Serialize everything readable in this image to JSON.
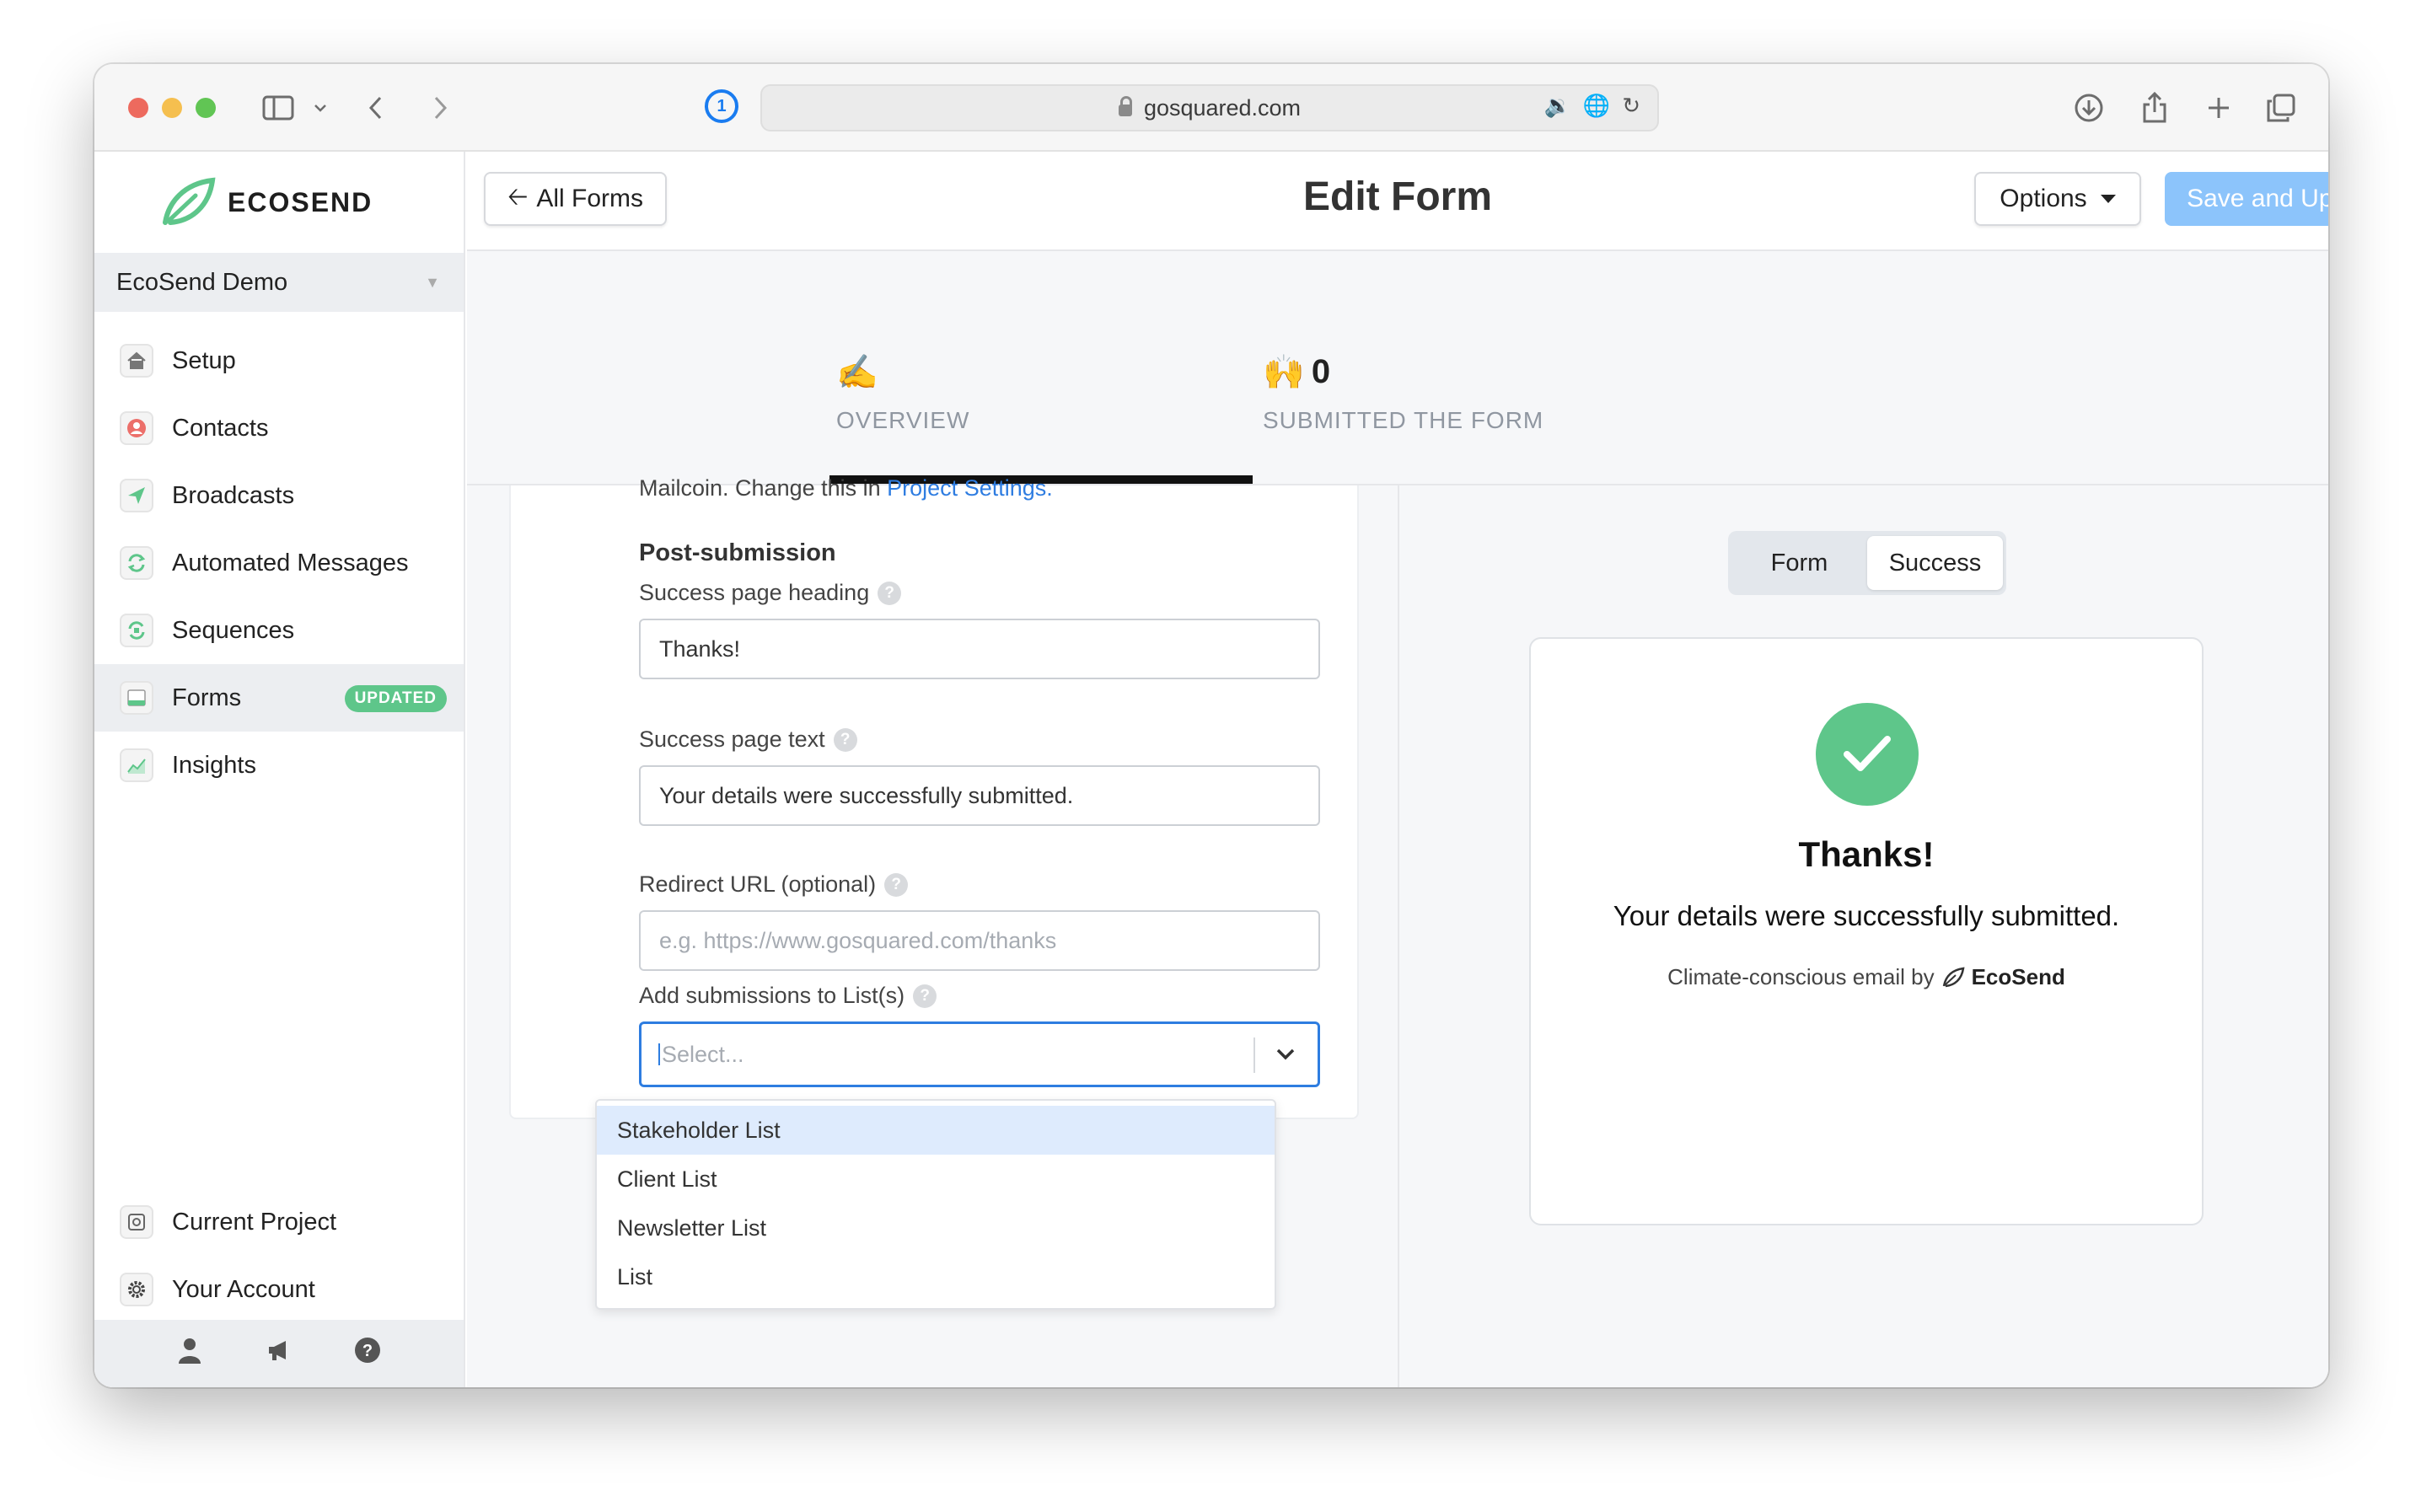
{
  "browser": {
    "url": "gosquared.com"
  },
  "sidebar": {
    "brand": "ECOSEND",
    "project": "EcoSend Demo",
    "items": [
      {
        "label": "Setup",
        "icon": "home-icon"
      },
      {
        "label": "Contacts",
        "icon": "contacts-icon"
      },
      {
        "label": "Broadcasts",
        "icon": "send-icon"
      },
      {
        "label": "Automated Messages",
        "icon": "repeat-icon"
      },
      {
        "label": "Sequences",
        "icon": "sequence-icon"
      },
      {
        "label": "Forms",
        "icon": "form-icon",
        "badge": "UPDATED",
        "active": true
      },
      {
        "label": "Insights",
        "icon": "chart-icon"
      }
    ],
    "bottom_items": [
      {
        "label": "Current Project",
        "icon": "project-icon"
      },
      {
        "label": "Your Account",
        "icon": "gear-icon"
      }
    ]
  },
  "header": {
    "back_label": "All Forms",
    "title": "Edit Form",
    "options_label": "Options",
    "save_label": "Save and Update"
  },
  "stats": [
    {
      "emoji": "✍️",
      "value": "",
      "label": "OVERVIEW"
    },
    {
      "emoji": "🙌",
      "value": "0",
      "label": "SUBMITTED THE FORM"
    }
  ],
  "form": {
    "cut_text_prefix": "Mailcoin. Change this in ",
    "cut_text_link": "Project Settings.",
    "section_title": "Post-submission",
    "fields": {
      "heading_label": "Success page heading",
      "heading_value": "Thanks!",
      "text_label": "Success page text",
      "text_value": "Your details were successfully submitted.",
      "redirect_label": "Redirect URL (optional)",
      "redirect_placeholder": "e.g. https://www.gosquared.com/thanks",
      "lists_label": "Add submissions to List(s)",
      "lists_placeholder": "Select..."
    },
    "list_options": [
      "Stakeholder List",
      "Client List",
      "Newsletter List",
      "List"
    ]
  },
  "preview": {
    "toggle_form": "Form",
    "toggle_success": "Success",
    "heading": "Thanks!",
    "text": "Your details were successfully submitted.",
    "footer_prefix": "Climate-conscious email by",
    "footer_brand": "EcoSend"
  },
  "colors": {
    "accent_blue": "#2e7de0",
    "save_button": "#8cc4fb",
    "brand_green": "#5ec68a"
  }
}
